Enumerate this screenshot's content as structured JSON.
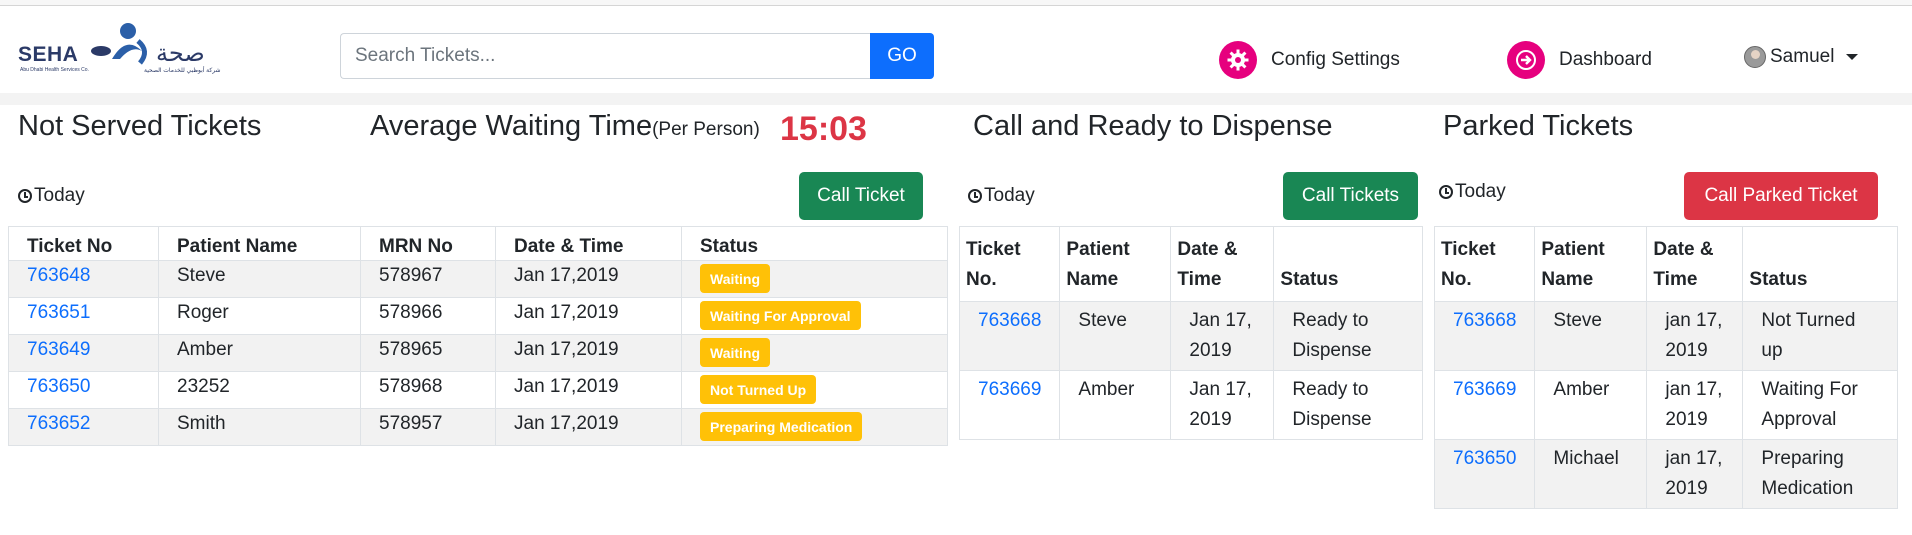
{
  "logo": {
    "name": "SEHA",
    "subtitle_en": "Abu Dhabi Health Services Co.",
    "subtitle_ar": "شركة أبوظبي للخدمات الصحية"
  },
  "search": {
    "placeholder": "Search Tickets...",
    "go_label": "GO"
  },
  "nav": {
    "config": {
      "label": "Config Settings",
      "icon": "gear-icon"
    },
    "dashboard": {
      "label": "Dashboard",
      "icon": "arrow-right-circle-icon"
    },
    "user": {
      "name": "Samuel"
    }
  },
  "colors": {
    "accent_pink": "#e6007e",
    "primary": "#0d6efd",
    "success": "#198754",
    "danger": "#dc3545",
    "warning": "#ffc107"
  },
  "not_served": {
    "title": "Not Served Tickets",
    "filter": "Today",
    "button": "Call Ticket",
    "columns": [
      "Ticket No",
      "Patient Name",
      "MRN No",
      "Date & Time",
      "Status"
    ],
    "rows": [
      {
        "ticket": "763648",
        "patient": "Steve",
        "mrn": "578967",
        "date": "Jan 17,2019",
        "status": "Waiting"
      },
      {
        "ticket": "763651",
        "patient": "Roger",
        "mrn": "578966",
        "date": "Jan 17,2019",
        "status": "Waiting For Approval"
      },
      {
        "ticket": "763649",
        "patient": "Amber",
        "mrn": "578965",
        "date": "Jan 17,2019",
        "status": "Waiting"
      },
      {
        "ticket": "763650",
        "patient": "23252",
        "mrn": "578968",
        "date": "Jan 17,2019",
        "status": "Not Turned Up"
      },
      {
        "ticket": "763652",
        "patient": "Smith",
        "mrn": "578957",
        "date": "Jan 17,2019",
        "status": "Preparing Medication"
      }
    ]
  },
  "avg_wait": {
    "title": "Average Waiting Time",
    "subtitle": "(Per Person)",
    "value": "15:03"
  },
  "ready": {
    "title": "Call and Ready to Dispense",
    "filter": "Today",
    "button": "Call Tickets",
    "columns": [
      "Ticket No.",
      "Patient Name",
      "Date & Time",
      "Status"
    ],
    "rows": [
      {
        "ticket": "763668",
        "patient": "Steve",
        "date": "Jan 17, 2019",
        "status": "Ready to Dispense"
      },
      {
        "ticket": "763669",
        "patient": "Amber",
        "date": "Jan 17, 2019",
        "status": "Ready to Dispense"
      }
    ]
  },
  "parked": {
    "title": "Parked Tickets",
    "filter": "Today",
    "button": "Call Parked Ticket",
    "columns": [
      "Ticket No.",
      "Patient Name",
      "Date & Time",
      "Status"
    ],
    "rows": [
      {
        "ticket": "763668",
        "patient": "Steve",
        "date": "jan 17, 2019",
        "status": "Not Turned up"
      },
      {
        "ticket": "763669",
        "patient": "Amber",
        "date": "jan 17, 2019",
        "status": "Waiting For Approval"
      },
      {
        "ticket": "763650",
        "patient": "Michael",
        "date": "jan 17, 2019",
        "status": "Preparing Medication"
      }
    ]
  }
}
